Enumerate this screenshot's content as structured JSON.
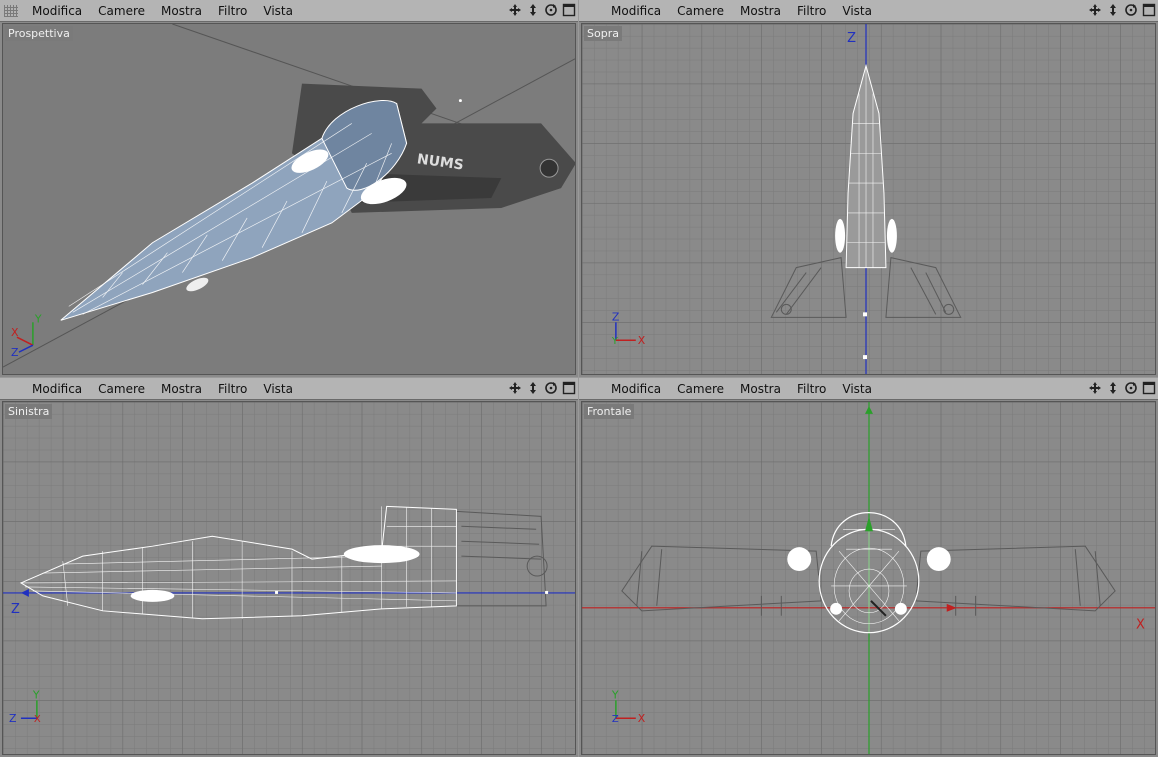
{
  "menus": [
    "Modifica",
    "Camere",
    "Mostra",
    "Filtro",
    "Vista"
  ],
  "viewports": {
    "perspective": {
      "label": "Prospettiva",
      "logo_text": "NUMS"
    },
    "top": {
      "label": "Sopra",
      "axis_main": "Z"
    },
    "left": {
      "label": "Sinistra",
      "axis_main": "Z"
    },
    "front": {
      "label": "Frontale",
      "axis_main": "X"
    }
  },
  "axes": {
    "x": "X",
    "y": "Y",
    "z": "Z"
  },
  "colors": {
    "viewport_bg": "#8a8a8a",
    "grid_line": "#7a7a7a",
    "wire": "#ffffff",
    "hull_fill": "#7f97b3",
    "axis_x": "#c02020",
    "axis_y": "#2aa02a",
    "axis_z": "#2030c0"
  },
  "icons": [
    "move-icon",
    "zoom-icon",
    "rotate-icon",
    "maximize-icon"
  ]
}
